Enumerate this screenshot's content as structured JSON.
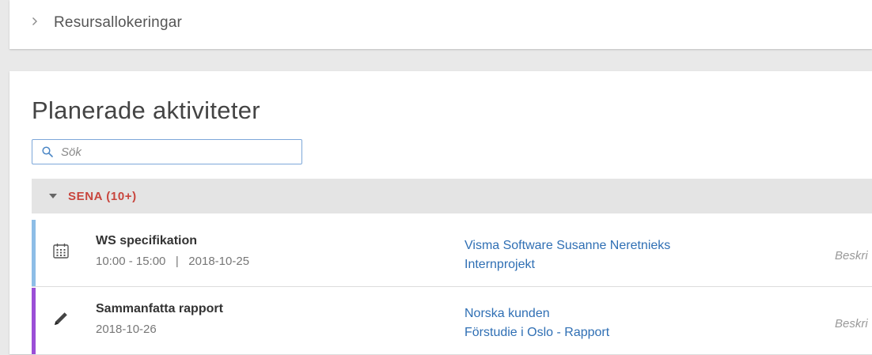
{
  "resource_section": {
    "title": "Resursallokeringar",
    "icon": "chevron-right-icon"
  },
  "planned": {
    "title": "Planerade aktiviteter",
    "search": {
      "placeholder": "Sök",
      "value": ""
    },
    "group": {
      "label": "SENA (10+)",
      "color": "#c8453d",
      "icon": "caret-down-icon"
    },
    "activities": [
      {
        "title": "WS specifikation",
        "meta": "10:00 - 15:00   |   2018-10-25",
        "icon": "calendar-icon",
        "stripe_color": "#8dbde6",
        "link1": "Visma Software Susanne Neretnieks",
        "link2": "Internprojekt",
        "description": "Beskri"
      },
      {
        "title": "Sammanfatta rapport",
        "meta": "2018-10-26",
        "icon": "pencil-icon",
        "stripe_color": "#9b4fd6",
        "link1": "Norska kunden",
        "link2": "Förstudie i Oslo - Rapport",
        "description": "Beskri"
      }
    ]
  },
  "colors": {
    "link": "#2f6fb4",
    "search_border": "#7da7d9"
  }
}
